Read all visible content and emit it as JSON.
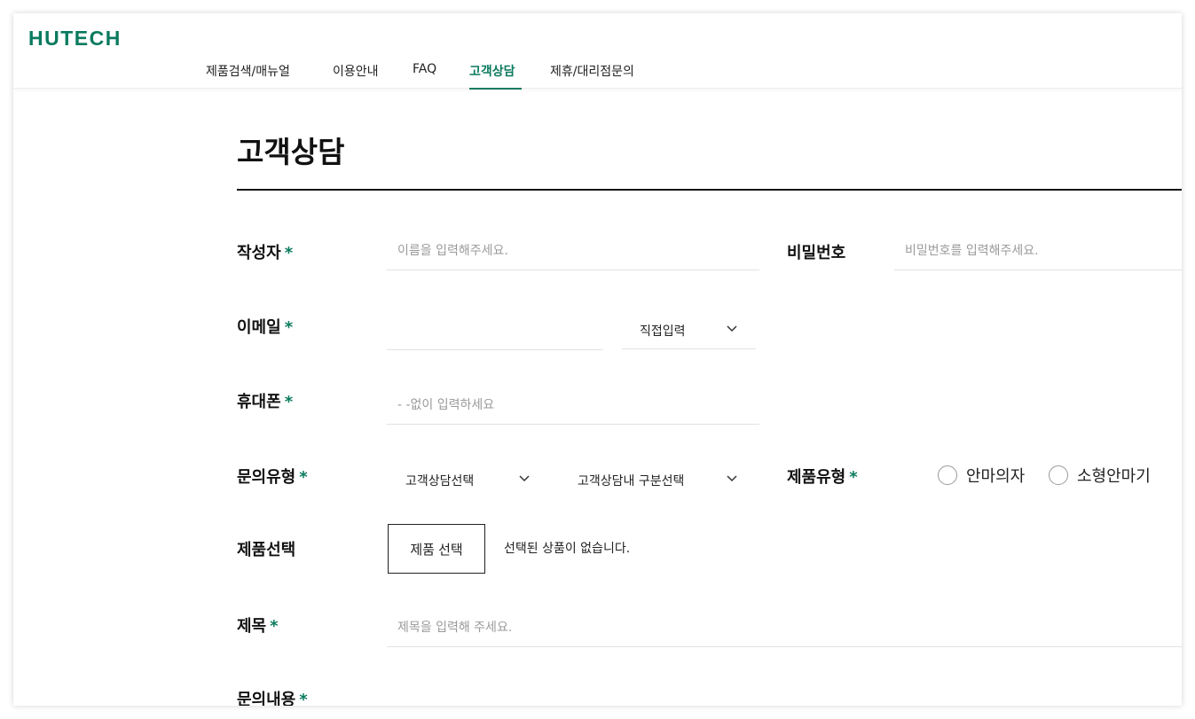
{
  "brand": {
    "logo": "HUTECH",
    "accent_color": "#0a7a5e"
  },
  "nav": {
    "items": [
      {
        "label": "제품검색/매뉴얼",
        "active": false
      },
      {
        "label": "이용안내",
        "active": false
      },
      {
        "label": "FAQ",
        "active": false
      },
      {
        "label": "고객상담",
        "active": true
      },
      {
        "label": "제휴/대리점문의",
        "active": false
      }
    ]
  },
  "page": {
    "title": "고객상담"
  },
  "form": {
    "required_mark": "*",
    "writer": {
      "label": "작성자",
      "placeholder": "이름을 입력해주세요."
    },
    "password": {
      "label": "비밀번호",
      "placeholder": "비밀번호를 입력해주세요."
    },
    "email": {
      "label": "이메일",
      "value": "",
      "domain_select": "직접입력"
    },
    "phone": {
      "label": "휴대폰",
      "placeholder": "- -없이 입력하세요"
    },
    "inquiry_type": {
      "label": "문의유형",
      "select1": "고객상담선택",
      "select2": "고객상담내 구분선택"
    },
    "product_type": {
      "label": "제품유형",
      "options": [
        "안마의자",
        "소형안마기"
      ]
    },
    "product_select": {
      "label": "제품선택",
      "button": "제품 선택",
      "status": "선택된 상품이 없습니다."
    },
    "subject": {
      "label": "제목",
      "placeholder": "제목을 입력해 주세요."
    },
    "content": {
      "label": "문의내용"
    }
  },
  "icons": {
    "chevron": "chevron-down-icon",
    "radio": "radio-icon"
  }
}
